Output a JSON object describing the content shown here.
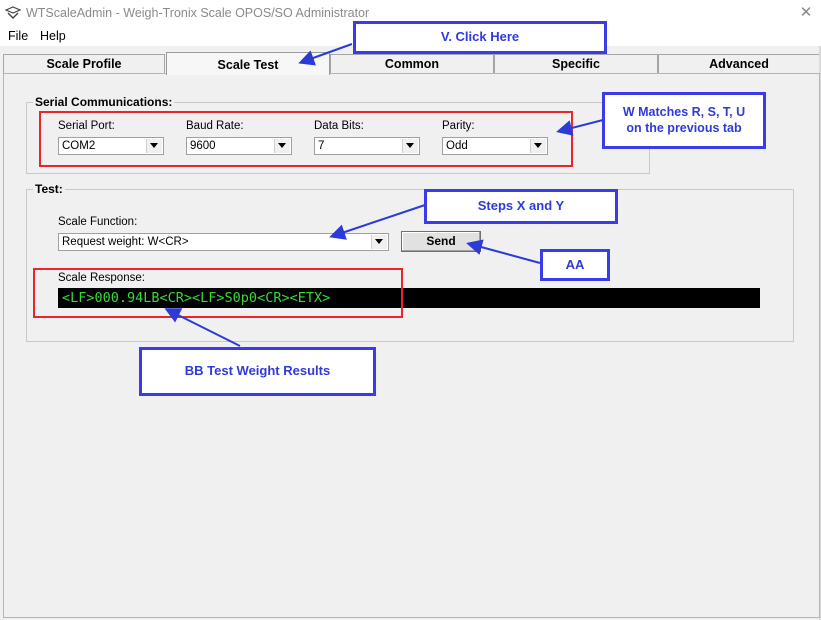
{
  "window": {
    "title": "WTScaleAdmin - Weigh-Tronix Scale OPOS/SO Administrator"
  },
  "menu": [
    "File",
    "Help"
  ],
  "tabs": [
    "Scale Profile",
    "Scale Test",
    "Common",
    "Specific",
    "Advanced"
  ],
  "active_tab": "Scale Test",
  "serial": {
    "group_label": "Serial Communications:",
    "port_label": "Serial Port:",
    "port_value": "COM2",
    "baud_label": "Baud Rate:",
    "baud_value": "9600",
    "bits_label": "Data Bits:",
    "bits_value": "7",
    "parity_label": "Parity:",
    "parity_value": "Odd"
  },
  "test": {
    "group_label": "Test:",
    "function_label": "Scale Function:",
    "function_value": "Request weight:  W<CR>",
    "send_label": "Send",
    "response_label": "Scale Response:",
    "response_value": "<LF>000.94LB<CR><LF>S0p0<CR><ETX>"
  },
  "annotations": {
    "v": "V. Click Here",
    "w_line1": "W Matches R, S, T, U",
    "w_line2": "on the previous tab",
    "xy": "Steps X and Y",
    "aa": "AA",
    "bb": "BB Test Weight Results"
  },
  "colors": {
    "callout_border": "#3b3bea",
    "callout_text": "#2e3bd9",
    "highlight_red": "#e8272d",
    "response_text": "#39d839"
  }
}
